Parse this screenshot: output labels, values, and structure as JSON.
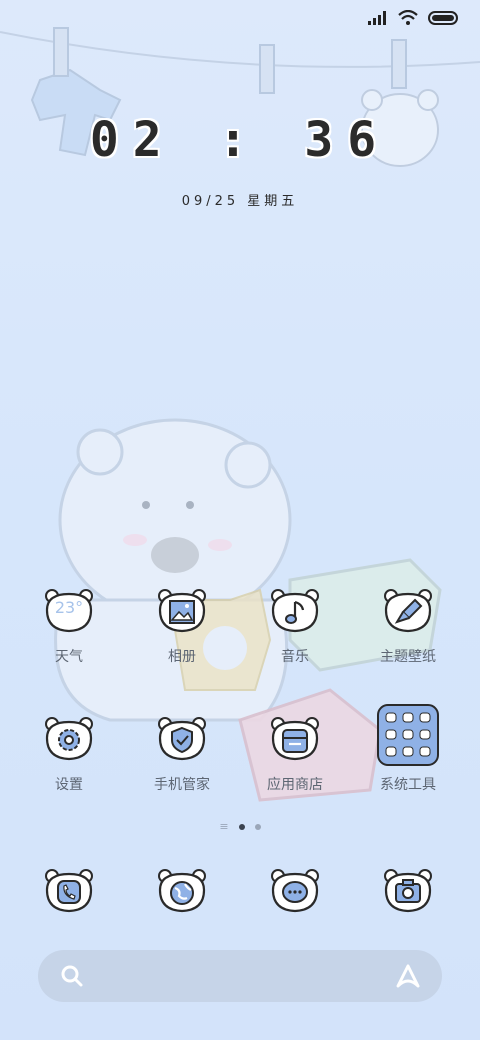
{
  "clock": {
    "time": "02 : 36",
    "date": "09/25  星期五"
  },
  "apps": [
    {
      "name": "weather",
      "label": "天气",
      "icon": "weather-icon",
      "temp": "23°"
    },
    {
      "name": "gallery",
      "label": "相册",
      "icon": "gallery-icon"
    },
    {
      "name": "music",
      "label": "音乐",
      "icon": "music-note-icon"
    },
    {
      "name": "themes",
      "label": "主题壁纸",
      "icon": "paint-brush-icon"
    },
    {
      "name": "settings",
      "label": "设置",
      "icon": "gear-icon"
    },
    {
      "name": "security",
      "label": "手机管家",
      "icon": "shield-check-icon"
    },
    {
      "name": "appstore",
      "label": "应用商店",
      "icon": "store-icon"
    },
    {
      "name": "tools",
      "label": "系统工具",
      "icon": "folder-icon"
    }
  ],
  "dock": [
    {
      "name": "phone",
      "icon": "phone-icon"
    },
    {
      "name": "browser",
      "icon": "globe-icon"
    },
    {
      "name": "messages",
      "icon": "chat-bubble-icon"
    },
    {
      "name": "camera",
      "icon": "camera-icon"
    }
  ],
  "colors": {
    "accent": "#8fb1e6",
    "outline": "#2a2a2a",
    "label": "#5d6673"
  }
}
